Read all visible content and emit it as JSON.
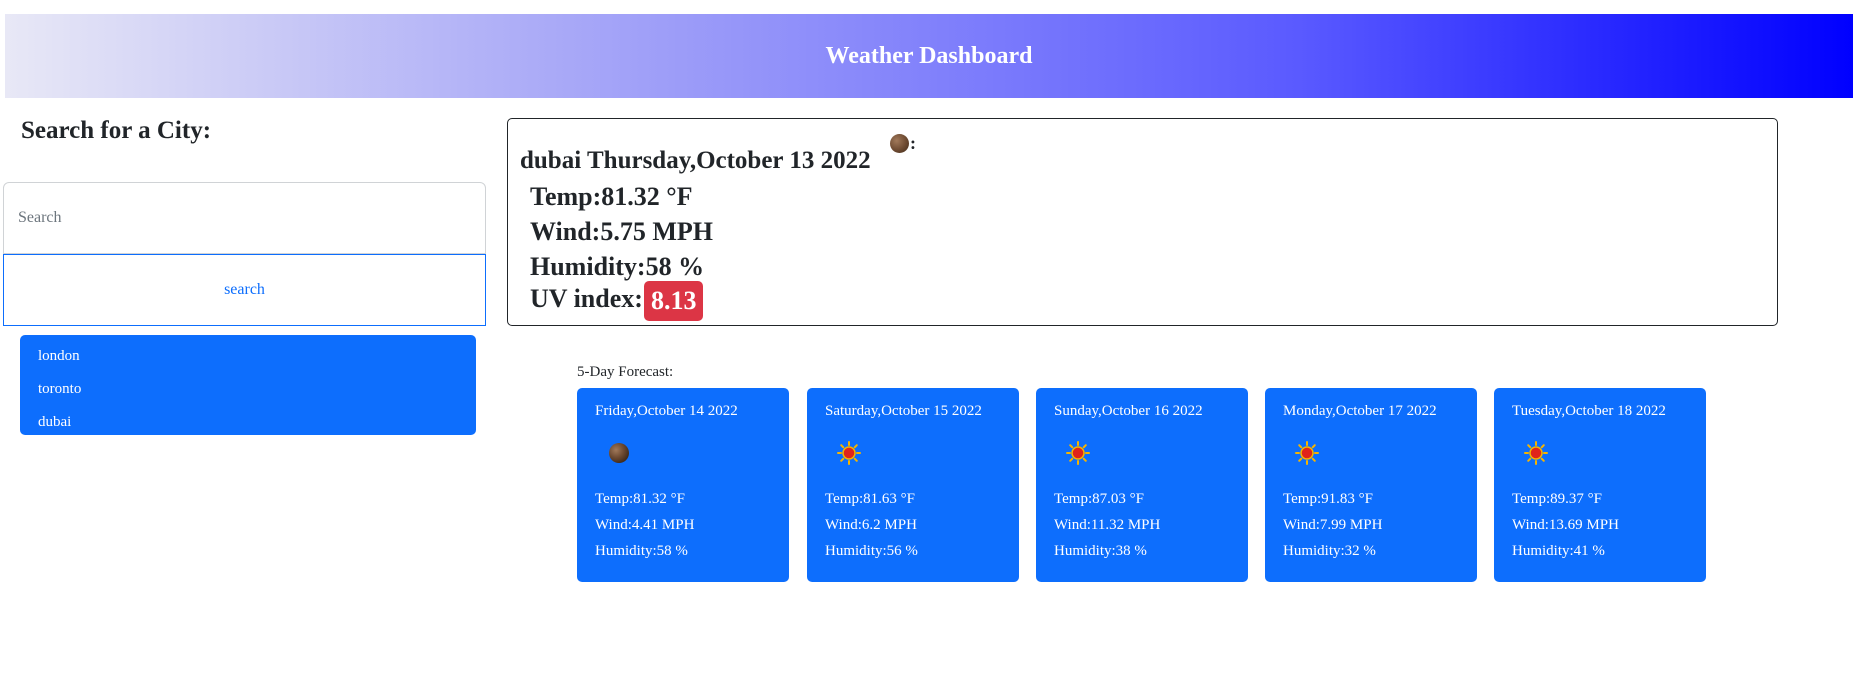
{
  "header": {
    "title": "Weather Dashboard"
  },
  "sidebar": {
    "heading": "Search for a City:",
    "search": {
      "placeholder": "Search",
      "value": "",
      "button_label": "search"
    },
    "history": [
      "london",
      "toronto",
      "dubai"
    ]
  },
  "current": {
    "city": "dubai",
    "date": "Thursday,October 13 2022",
    "icon": "moon-icon",
    "icon_suffix": ":",
    "temp": "Temp:81.32 °F",
    "wind": "Wind:5.75 MPH",
    "humidity": "Humidity:58 %",
    "uv_label": "UV index:",
    "uv_value": "8.13",
    "uv_color": "#dc3545"
  },
  "forecast": {
    "label": "5-Day Forecast:",
    "days": [
      {
        "date": "Friday,October 14 2022",
        "icon": "moon-icon",
        "temp": "Temp:81.32 °F",
        "wind": "Wind:4.41 MPH",
        "humidity": "Humidity:58 %"
      },
      {
        "date": "Saturday,October 15 2022",
        "icon": "sun-icon",
        "temp": "Temp:81.63 °F",
        "wind": "Wind:6.2 MPH",
        "humidity": "Humidity:56 %"
      },
      {
        "date": "Sunday,October 16 2022",
        "icon": "sun-icon",
        "temp": "Temp:87.03 °F",
        "wind": "Wind:11.32 MPH",
        "humidity": "Humidity:38 %"
      },
      {
        "date": "Monday,October 17 2022",
        "icon": "sun-icon",
        "temp": "Temp:91.83 °F",
        "wind": "Wind:7.99 MPH",
        "humidity": "Humidity:32 %"
      },
      {
        "date": "Tuesday,October 18 2022",
        "icon": "sun-icon",
        "temp": "Temp:89.37 °F",
        "wind": "Wind:13.69 MPH",
        "humidity": "Humidity:41 %"
      }
    ]
  },
  "colors": {
    "accent": "#0d6efd",
    "header_end": "#0000ff",
    "uv_high": "#dc3545"
  }
}
